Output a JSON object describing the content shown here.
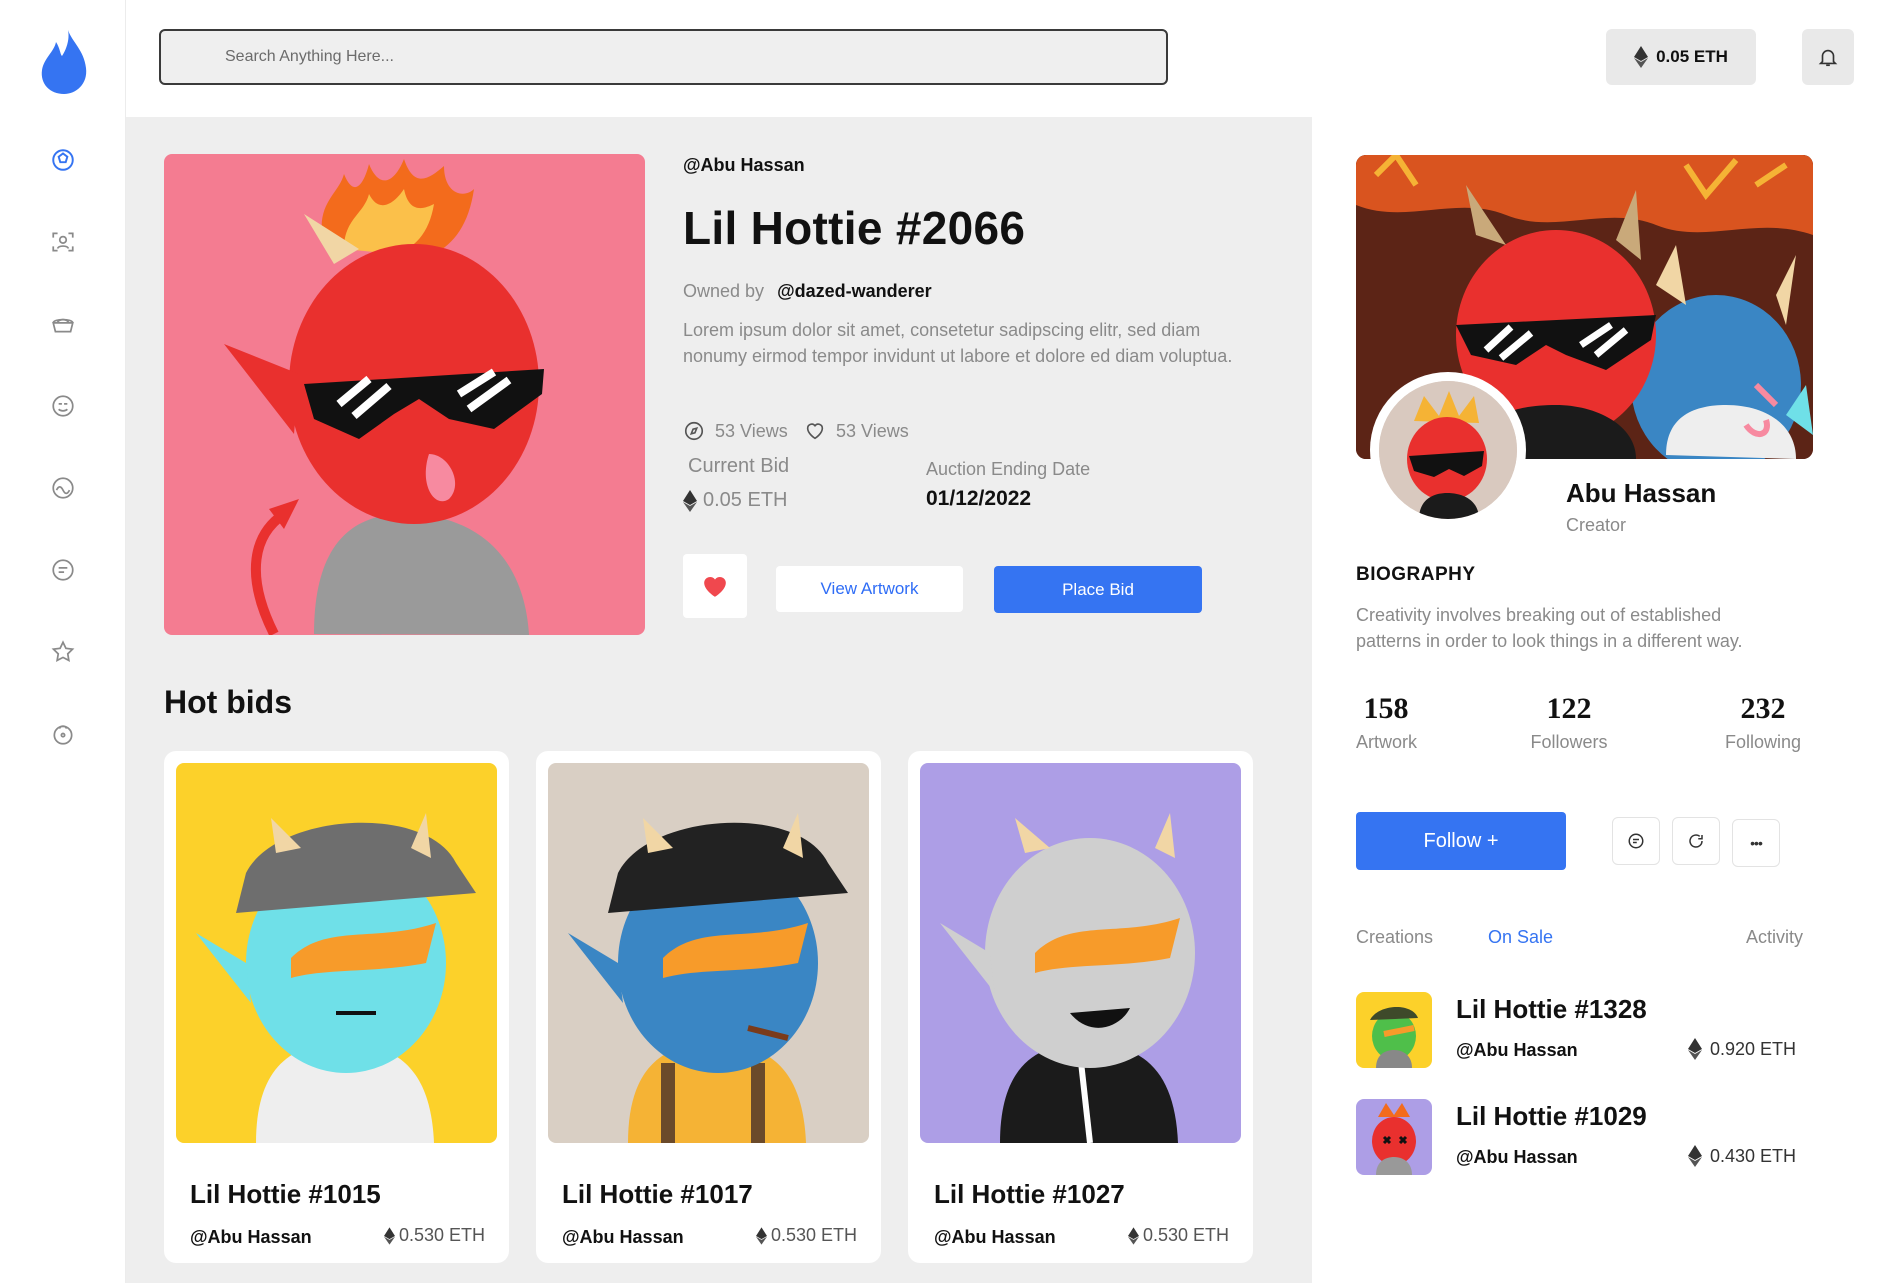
{
  "search": {
    "placeholder": "Search Anything Here..."
  },
  "wallet": {
    "balance": "0.05 ETH"
  },
  "hero": {
    "handle": "@Abu Hassan",
    "title": "Lil Hottie #2066",
    "owned_label": "Owned by",
    "owner": "@dazed-wanderer",
    "description": "Lorem ipsum dolor sit amet, consetetur sadipscing elitr, sed diam nonumy eirmod tempor invidunt ut labore et dolore ed diam voluptua.",
    "views_1": "53 Views",
    "views_2": "53 Views",
    "current_bid_label": "Current Bid",
    "current_bid": "0.05 ETH",
    "auction_label": "Auction Ending Date",
    "auction_date": "01/12/2022",
    "view_button": "View Artwork",
    "bid_button": "Place Bid",
    "art_bg": "#f47c91"
  },
  "hot_bids": {
    "title": "Hot bids",
    "cards": [
      {
        "title": "Lil Hottie #1015",
        "handle": "@Abu Hassan",
        "price": "0.530 ETH",
        "bg": "#fcd12a"
      },
      {
        "title": "Lil Hottie #1017",
        "handle": "@Abu Hassan",
        "price": "0.530 ETH",
        "bg": "#d9cfc4"
      },
      {
        "title": "Lil Hottie #1027",
        "handle": "@Abu Hassan",
        "price": "0.530 ETH",
        "bg": "#ad9ee6"
      }
    ]
  },
  "profile": {
    "name": "Abu Hassan",
    "role": "Creator",
    "bio_heading": "BIOGRAPHY",
    "bio": "Creativity involves breaking out of established patterns in order to look things in a different way.",
    "stats": [
      {
        "value": "158",
        "label": "Artwork"
      },
      {
        "value": "122",
        "label": "Followers"
      },
      {
        "value": "232",
        "label": "Following"
      }
    ],
    "follow_button": "Follow +",
    "more_label": "•••",
    "tabs": [
      "Creations",
      "On Sale",
      "Activity"
    ],
    "active_tab": "On Sale",
    "items": [
      {
        "title": "Lil Hottie #1328",
        "handle": "@Abu Hassan",
        "price": "0.920 ETH",
        "bg": "#fcd12a"
      },
      {
        "title": "Lil Hottie #1029",
        "handle": "@Abu Hassan",
        "price": "0.430 ETH",
        "bg": "#ad9ee6"
      }
    ]
  },
  "colors": {
    "accent": "#3574f2",
    "heart": "#f0484e"
  },
  "nav": [
    "home-icon",
    "profile-scan-icon",
    "basket-icon",
    "emoji-icon",
    "activity-icon",
    "chat-icon",
    "star-icon",
    "wallet-icon"
  ]
}
